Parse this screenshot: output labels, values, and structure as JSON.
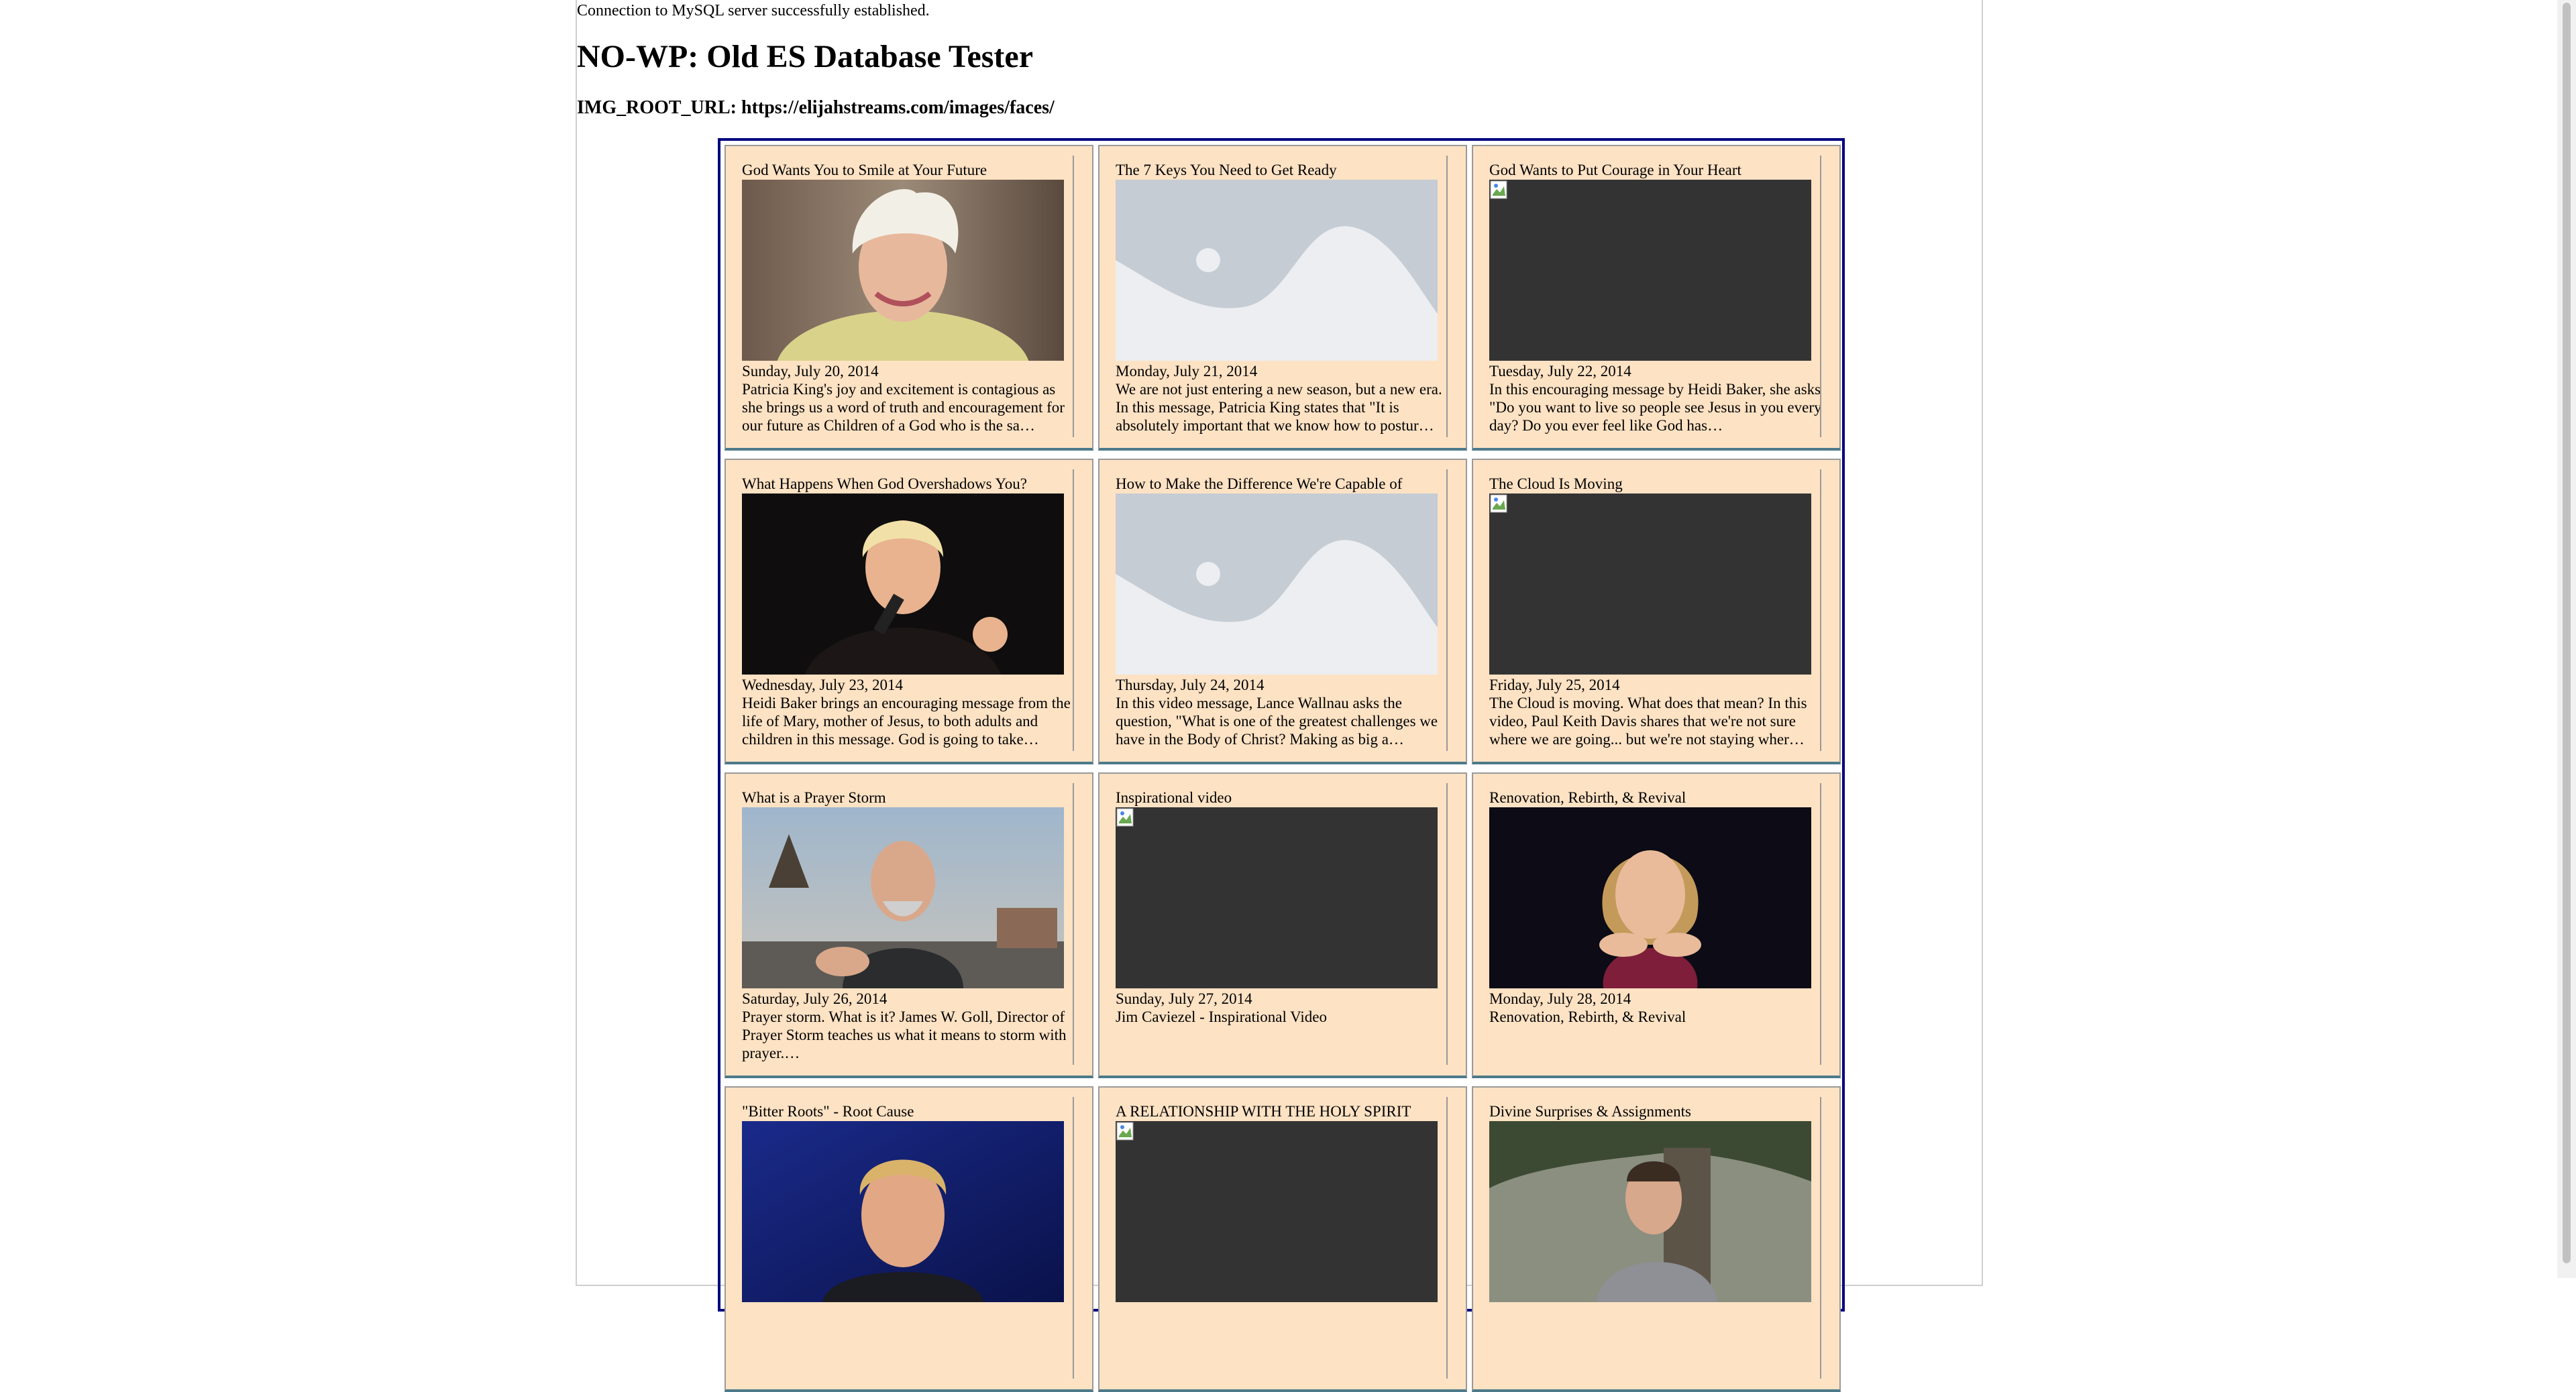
{
  "status_text": "Connection to MySQL server successfully established.",
  "page_title": "NO-WP: Old ES Database Tester",
  "img_root_label": "IMG_ROOT_URL: https://elijahstreams.com/images/faces/",
  "cards": [
    {
      "title": "God Wants You to Smile at Your Future",
      "image": "photo-woman-white-hair",
      "date": "Sunday, July 20, 2014",
      "description": "Patricia King's joy and excitement is contagious as she brings us a word of truth and encouragement for our future as Children of a God who is the sa…"
    },
    {
      "title": "The 7 Keys You Need to Get Ready",
      "image": "image-placeholder",
      "date": "Monday, July 21, 2014",
      "description": "We are not just entering a new season, but a new era. In this message, Patricia King states that \"It is absolutely important that we know how to postur…"
    },
    {
      "title": "God Wants to Put Courage in Your Heart",
      "image": "broken-image",
      "date": "Tuesday, July 22, 2014",
      "description": "In this encouraging message by Heidi Baker, she asks, \"Do you want to live so people see Jesus in you every day? Do you ever feel like God has…"
    },
    {
      "title": "What Happens When God Overshadows You?",
      "image": "photo-speaker-microphone",
      "date": "Wednesday, July 23, 2014",
      "description": "Heidi Baker brings an encouraging message from the life of Mary, mother of Jesus, to both adults and children in this message. God is going to take…"
    },
    {
      "title": "How to Make the Difference We're Capable of",
      "image": "image-placeholder",
      "date": "Thursday, July 24, 2014",
      "description": "In this video message, Lance Wallnau asks the question, \"What is one of the greatest challenges we have in the Body of Christ? Making as big a…"
    },
    {
      "title": "The Cloud Is Moving",
      "image": "broken-image",
      "date": "Friday, July 25, 2014",
      "description": "The Cloud is moving. What does that mean? In this video, Paul Keith Davis shares that we're not sure where we are going... but we're not staying wher…"
    },
    {
      "title": "What is a Prayer Storm",
      "image": "photo-man-outdoors",
      "date": "Saturday, July 26, 2014",
      "description": "Prayer storm. What is it? James W. Goll, Director of Prayer Storm teaches us what it means to storm with prayer.…"
    },
    {
      "title": "Inspirational video",
      "image": "broken-image",
      "date": "Sunday, July 27, 2014",
      "description": "Jim Caviezel - Inspirational Video"
    },
    {
      "title": "Renovation, Rebirth, & Revival",
      "image": "photo-woman-blonde",
      "date": "Monday, July 28, 2014",
      "description": "Renovation, Rebirth, & Revival"
    },
    {
      "title": "\"Bitter Roots\" - Root Cause",
      "image": "photo-speaker-blue-stage",
      "date": "",
      "description": ""
    },
    {
      "title": "A RELATIONSHIP WITH THE HOLY SPIRIT",
      "image": "broken-image",
      "date": "",
      "description": ""
    },
    {
      "title": "Divine Surprises & Assignments",
      "image": "photo-man-tree",
      "date": "",
      "description": ""
    }
  ]
}
